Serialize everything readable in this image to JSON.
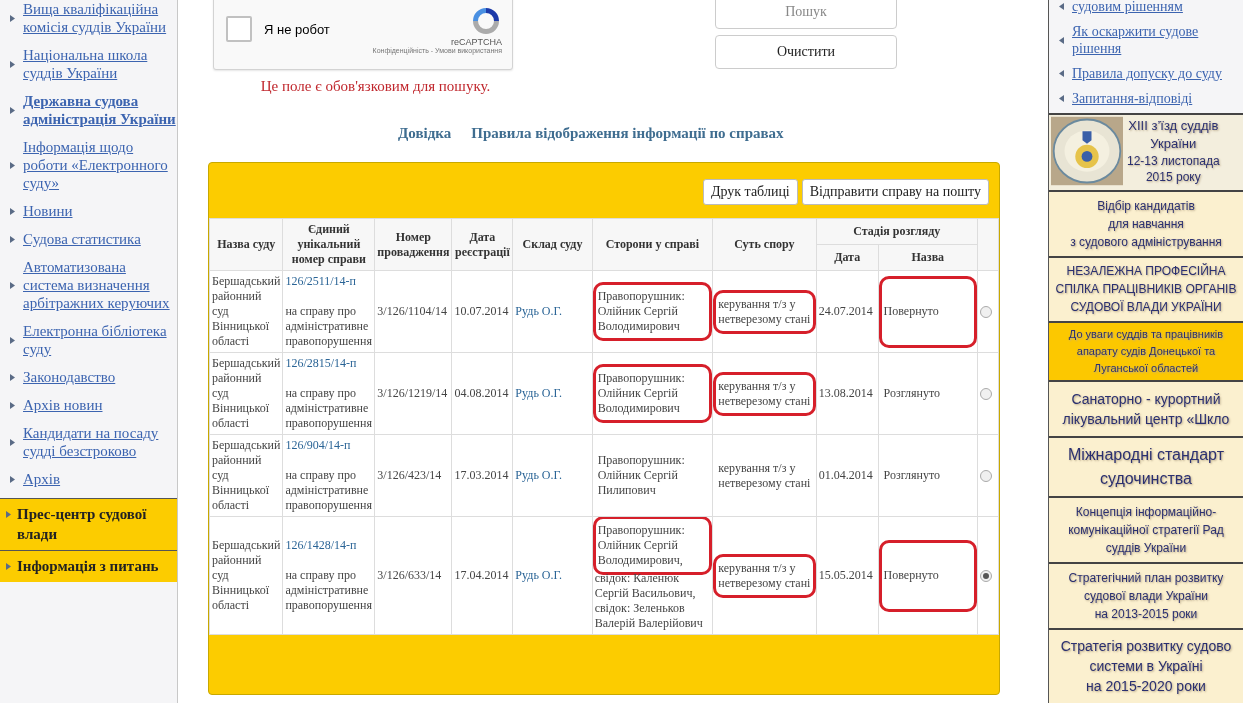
{
  "sidebar": {
    "items": [
      {
        "label": "Вища кваліфікаційна комісія суддів України",
        "bold": false
      },
      {
        "label": "Національна школа суддів України",
        "bold": false
      },
      {
        "label": "Державна судова адміністрація України",
        "bold": true
      },
      {
        "label": "Інформація щодо роботи «Електронного суду»",
        "bold": false
      },
      {
        "label": "Новини",
        "bold": false
      },
      {
        "label": "Судова статистика",
        "bold": false
      },
      {
        "label": "Автоматизована система визначення арбітражних керуючих",
        "bold": false
      },
      {
        "label": "Електронна бібліотека суду",
        "bold": false
      },
      {
        "label": "Законодавство",
        "bold": false
      },
      {
        "label": "Архів новин",
        "bold": false
      },
      {
        "label": "Кандидати на посаду судді безстроково",
        "bold": false
      },
      {
        "label": "Архів",
        "bold": false
      }
    ],
    "sections": [
      {
        "label": "Прес-центр судової влади"
      },
      {
        "label": "Інформація з питань"
      }
    ]
  },
  "captcha": {
    "label": "Я не робот",
    "checked": false,
    "brand": "reCAPTCHA",
    "terms": "Конфіденційність - Умови використання"
  },
  "search_buttons": [
    {
      "label": "Пошук",
      "disabled": true
    },
    {
      "label": "Очистити",
      "disabled": false
    }
  ],
  "error": "Це поле є обов'язковим для пошуку.",
  "links": [
    "Довідка",
    "Правила відображення інформації по справах"
  ],
  "table": {
    "toolbar": [
      "Друк таблиці",
      "Відправити справу на пошту"
    ],
    "columns": [
      "Назва суду",
      "Єдиний унікальний номер справи",
      "Номер провадження",
      "Дата реєстрації",
      "Склад суду",
      "Сторони у справі",
      "Суть спору"
    ],
    "stage_group": "Стадія розгляду",
    "stage_columns": [
      "Дата",
      "Назва"
    ],
    "rows": [
      {
        "court": "Бершадський районний суд Вінницької області",
        "case_number": "126/2511/14-п",
        "case_note": "на справу про адміністративне правопорушення",
        "proceeding": "3/126/1104/14",
        "registered": "10.07.2014",
        "judge": "Рудь О.Г.",
        "parties": "Правопорушник: Олійник Сергій Володимирович",
        "parties_circled": true,
        "essence": "керування т/з у нетверезому стані",
        "essence_circled": true,
        "stage_date": "24.07.2014",
        "stage_name": "Повернуто",
        "stage_circled": true,
        "selected": false
      },
      {
        "court": "Бершадський районний суд Вінницької області",
        "case_number": "126/2815/14-п",
        "case_note": "на справу про адміністративне правопорушення",
        "proceeding": "3/126/1219/14",
        "registered": "04.08.2014",
        "judge": "Рудь О.Г.",
        "parties": "Правопорушник: Олійник Сергій Володимирович",
        "parties_circled": true,
        "essence": "керування т/з у нетверезому стані",
        "essence_circled": true,
        "stage_date": "13.08.2014",
        "stage_name": "Розглянуто",
        "stage_circled": false,
        "selected": false
      },
      {
        "court": "Бершадський районний суд Вінницької області",
        "case_number": "126/904/14-п",
        "case_note": "на справу про адміністративне правопорушення",
        "proceeding": "3/126/423/14",
        "registered": "17.03.2014",
        "judge": "Рудь О.Г.",
        "parties": "Правопорушник: Олійник Сергій Пилипович",
        "parties_circled": false,
        "essence": "керування т/з у нетверезому стані",
        "essence_circled": false,
        "stage_date": "01.04.2014",
        "stage_name": "Розглянуто",
        "stage_circled": false,
        "selected": false
      },
      {
        "court": "Бершадський районний суд Вінницької області",
        "case_number": "126/1428/14-п",
        "case_note": "на справу про адміністративне правопорушення",
        "proceeding": "3/126/633/14",
        "registered": "17.04.2014",
        "judge": "Рудь О.Г.",
        "parties": "Правопорушник: Олійник Сергій Володимирович,",
        "parties_rest": "свідок: Каленюк Сергій Васильович, свідок: Зеленьков Валерій Валерійович",
        "parties_circled": true,
        "essence": "керування т/з у нетверезому стані",
        "essence_circled": true,
        "stage_date": "15.05.2014",
        "stage_name": "Повернуто",
        "stage_circled": true,
        "selected": true
      }
    ]
  },
  "right": {
    "links": [
      "судовим рішенням",
      "Як оскаржити судове рішення",
      "Правила допуску до суду",
      "Запитання-відповіді"
    ],
    "banners": [
      {
        "kind": "emblem",
        "text": "XIII з’їзд суддів\nУкраїни",
        "subtext": "12-13 листопада\n2015 року"
      },
      {
        "kind": "plain",
        "text": "Відбір кандидатів\nдля навчання\nз судового адміністрування"
      },
      {
        "kind": "plain",
        "text": "НЕЗАЛЕЖНА ПРОФЕСІЙНА\nСПІЛКА ПРАЦІВНИКІВ ОРГАНІВ\nСУДОВОЇ ВЛАДИ УКРАЇНИ"
      },
      {
        "kind": "accent",
        "text": "До уваги суддів та працівників\nапарату судів Донецької та\nЛуганської областей"
      },
      {
        "kind": "large",
        "text": "Санаторно - курортний\nлікувальний центр «Шкло"
      },
      {
        "kind": "huge",
        "text": "Міжнародні стандарт\nсудочинства"
      },
      {
        "kind": "plain",
        "text": "Концепція інформаційно-\nкомунікаційної стратегії Рад\nсуддів України"
      },
      {
        "kind": "plain",
        "text": "Стратегічний план розвитку\nсудової влади України\nна 2013-2015 роки"
      },
      {
        "kind": "large",
        "text": "Стратегія розвитку судово\nсистеми в Україні\nна 2015-2020 роки"
      }
    ]
  }
}
